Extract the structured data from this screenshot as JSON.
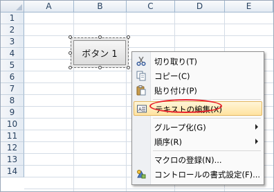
{
  "columns": [
    "A",
    "B",
    "C",
    "D",
    "E"
  ],
  "rows": [
    "1",
    "2",
    "3",
    "4",
    "5",
    "6",
    "7",
    "8",
    "9",
    "10",
    "11",
    "12",
    "13",
    "14"
  ],
  "form_button": {
    "label": "ボタン 1"
  },
  "context_menu": {
    "items": [
      {
        "label": "切り取り(T)",
        "icon": "scissors-icon"
      },
      {
        "label": "コピー(C)",
        "icon": "copy-icon"
      },
      {
        "label": "貼り付け(P)",
        "icon": "paste-icon"
      },
      {
        "label": "テキストの編集(X)",
        "icon": "edit-text-icon",
        "highlighted": true
      },
      {
        "label": "グループ化(G)",
        "submenu": true
      },
      {
        "label": "順序(R)",
        "submenu": true
      },
      {
        "label": "マクロの登録(N)..."
      },
      {
        "label": "コントロールの書式設定(F)...",
        "icon": "format-control-icon"
      }
    ]
  },
  "colors": {
    "highlight_ring": "#e8202a",
    "header_text": "#27415f"
  }
}
